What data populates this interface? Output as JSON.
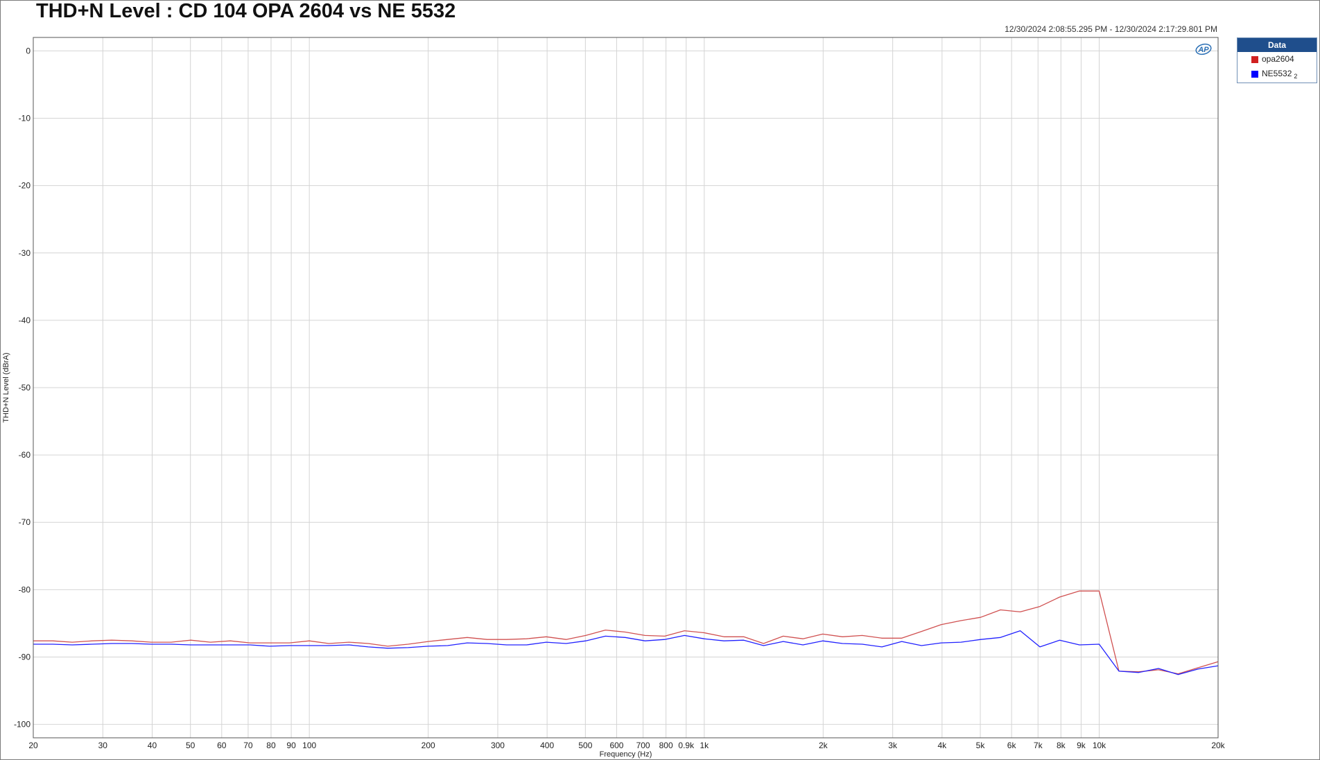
{
  "title": "THD+N Level : CD 104 OPA 2604 vs NE 5532",
  "timestamp": "12/30/2024 2:08:55.295 PM - 12/30/2024 2:17:29.801 PM",
  "legend": {
    "header": "Data",
    "items": [
      {
        "label": "opa2604",
        "sub": "",
        "color": "#d02020"
      },
      {
        "label": "NE5532",
        "sub": "2",
        "color": "#0000ff"
      }
    ]
  },
  "logo_text": "AP",
  "chart_data": {
    "type": "line",
    "xlabel": "Frequency (Hz)",
    "ylabel": "THD+N Level (dBrA)",
    "xscale": "log",
    "xlim": [
      20,
      20000
    ],
    "ylim": [
      -102,
      2
    ],
    "grid": true,
    "legend_position": "right, outside plot",
    "x_ticks": [
      {
        "v": 20,
        "label": "20"
      },
      {
        "v": 30,
        "label": "30"
      },
      {
        "v": 40,
        "label": "40"
      },
      {
        "v": 50,
        "label": "50"
      },
      {
        "v": 60,
        "label": "60"
      },
      {
        "v": 70,
        "label": "70"
      },
      {
        "v": 80,
        "label": "80"
      },
      {
        "v": 90,
        "label": "90"
      },
      {
        "v": 100,
        "label": "100"
      },
      {
        "v": 200,
        "label": "200"
      },
      {
        "v": 300,
        "label": "300"
      },
      {
        "v": 400,
        "label": "400"
      },
      {
        "v": 500,
        "label": "500"
      },
      {
        "v": 600,
        "label": "600"
      },
      {
        "v": 700,
        "label": "700"
      },
      {
        "v": 800,
        "label": "800"
      },
      {
        "v": 900,
        "label": "0.9k"
      },
      {
        "v": 1000,
        "label": "1k"
      },
      {
        "v": 2000,
        "label": "2k"
      },
      {
        "v": 3000,
        "label": "3k"
      },
      {
        "v": 4000,
        "label": "4k"
      },
      {
        "v": 5000,
        "label": "5k"
      },
      {
        "v": 6000,
        "label": "6k"
      },
      {
        "v": 7000,
        "label": "7k"
      },
      {
        "v": 8000,
        "label": "8k"
      },
      {
        "v": 9000,
        "label": "9k"
      },
      {
        "v": 10000,
        "label": "10k"
      },
      {
        "v": 20000,
        "label": "20k"
      }
    ],
    "y_ticks": [
      {
        "v": 0,
        "label": "0"
      },
      {
        "v": -10,
        "label": "-10"
      },
      {
        "v": -20,
        "label": "-20"
      },
      {
        "v": -30,
        "label": "-30"
      },
      {
        "v": -40,
        "label": "-40"
      },
      {
        "v": -50,
        "label": "-50"
      },
      {
        "v": -60,
        "label": "-60"
      },
      {
        "v": -70,
        "label": "-70"
      },
      {
        "v": -80,
        "label": "-80"
      },
      {
        "v": -90,
        "label": "-90"
      },
      {
        "v": -100,
        "label": "-100"
      }
    ],
    "series": [
      {
        "name": "opa2604",
        "color": "#d05050",
        "x": [
          20,
          22.4,
          25.1,
          28.2,
          31.6,
          35.5,
          39.8,
          44.7,
          50.1,
          56.2,
          63.1,
          70.8,
          79.4,
          89.1,
          100,
          112,
          126,
          141,
          158,
          178,
          200,
          224,
          251,
          282,
          316,
          355,
          398,
          447,
          501,
          562,
          631,
          708,
          794,
          891,
          1000,
          1122,
          1259,
          1413,
          1585,
          1778,
          1995,
          2239,
          2512,
          2818,
          3162,
          3548,
          3981,
          4467,
          5012,
          5623,
          6310,
          7079,
          7943,
          8913,
          10000,
          11220,
          12589,
          14125,
          15849,
          17783,
          20000
        ],
        "values": [
          -87.6,
          -87.6,
          -87.8,
          -87.6,
          -87.5,
          -87.6,
          -87.8,
          -87.8,
          -87.5,
          -87.8,
          -87.6,
          -87.9,
          -87.9,
          -87.9,
          -87.6,
          -88.0,
          -87.8,
          -88.0,
          -88.4,
          -88.1,
          -87.7,
          -87.4,
          -87.1,
          -87.4,
          -87.4,
          -87.3,
          -87.0,
          -87.4,
          -86.8,
          -86.0,
          -86.3,
          -86.8,
          -86.9,
          -86.1,
          -86.4,
          -87.0,
          -87.0,
          -88.0,
          -86.9,
          -87.3,
          -86.6,
          -87.0,
          -86.8,
          -87.2,
          -87.2,
          -86.2,
          -85.2,
          -84.6,
          -84.1,
          -83.0,
          -83.3,
          -82.5,
          -81.1,
          -80.2,
          -80.2,
          -92.1,
          -92.2,
          -91.9,
          -92.5,
          -91.6,
          -90.7
        ]
      },
      {
        "name": "NE5532",
        "color": "#2020ff",
        "x": [
          20,
          22.4,
          25.1,
          28.2,
          31.6,
          35.5,
          39.8,
          44.7,
          50.1,
          56.2,
          63.1,
          70.8,
          79.4,
          89.1,
          100,
          112,
          126,
          141,
          158,
          178,
          200,
          224,
          251,
          282,
          316,
          355,
          398,
          447,
          501,
          562,
          631,
          708,
          794,
          891,
          1000,
          1122,
          1259,
          1413,
          1585,
          1778,
          1995,
          2239,
          2512,
          2818,
          3162,
          3548,
          3981,
          4467,
          5012,
          5623,
          6310,
          7079,
          7943,
          8913,
          10000,
          11220,
          12589,
          14125,
          15849,
          17783,
          20000
        ],
        "values": [
          -88.1,
          -88.1,
          -88.2,
          -88.1,
          -88.0,
          -88.0,
          -88.1,
          -88.1,
          -88.2,
          -88.2,
          -88.2,
          -88.2,
          -88.4,
          -88.3,
          -88.3,
          -88.3,
          -88.2,
          -88.5,
          -88.7,
          -88.6,
          -88.4,
          -88.3,
          -87.9,
          -88.0,
          -88.2,
          -88.2,
          -87.8,
          -88.0,
          -87.6,
          -86.9,
          -87.1,
          -87.6,
          -87.4,
          -86.8,
          -87.3,
          -87.6,
          -87.5,
          -88.3,
          -87.7,
          -88.2,
          -87.6,
          -88.0,
          -88.1,
          -88.5,
          -87.7,
          -88.3,
          -87.9,
          -87.8,
          -87.4,
          -87.1,
          -86.1,
          -88.5,
          -87.5,
          -88.2,
          -88.1,
          -92.1,
          -92.3,
          -91.7,
          -92.6,
          -91.8,
          -91.3
        ]
      }
    ]
  }
}
